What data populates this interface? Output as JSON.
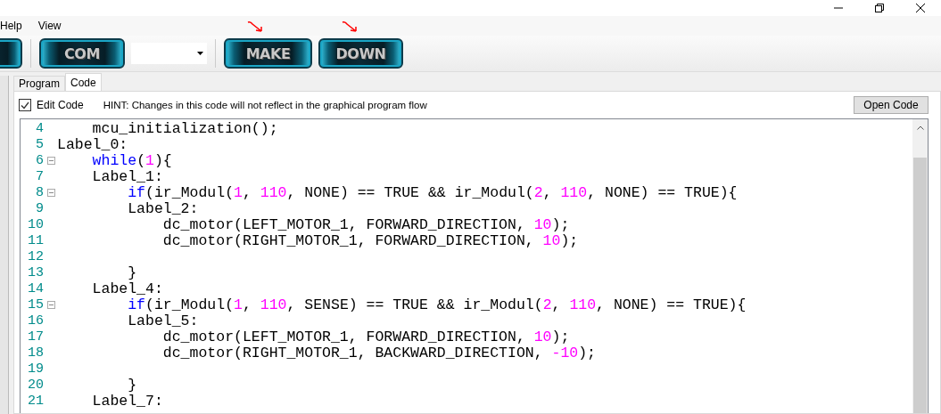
{
  "menu": [
    {
      "label": "Help"
    },
    {
      "label": "View"
    }
  ],
  "toolbar": {
    "buttons": [
      {
        "kind": "partial"
      },
      {
        "kind": "full",
        "label": "COM"
      }
    ],
    "actions": [
      {
        "label": "MAKE",
        "marked": true
      },
      {
        "label": "DOWN",
        "marked": true
      }
    ]
  },
  "tabs": [
    {
      "label": "Program",
      "selected": false
    },
    {
      "label": "Code",
      "selected": true
    }
  ],
  "edit_code": {
    "label": "Edit Code",
    "checked": true
  },
  "hint": "HINT: Changes in this code will not reflect in the graphical program flow",
  "open_button": "Open Code",
  "code_lines": [
    {
      "number": "4",
      "fold": false,
      "tokens": [
        {
          "kind": "plain",
          "text": "    mcu_initialization();"
        }
      ]
    },
    {
      "number": "5",
      "fold": false,
      "tokens": [
        {
          "kind": "plain",
          "text": "Label_0:"
        }
      ]
    },
    {
      "number": "6",
      "fold": true,
      "tokens": [
        {
          "kind": "keyword",
          "text": "    while"
        },
        {
          "kind": "plain",
          "text": "("
        },
        {
          "kind": "number",
          "text": "1"
        },
        {
          "kind": "plain",
          "text": "){"
        }
      ]
    },
    {
      "number": "7",
      "fold": false,
      "tokens": [
        {
          "kind": "plain",
          "text": "    Label_1:"
        }
      ]
    },
    {
      "number": "8",
      "fold": true,
      "tokens": [
        {
          "kind": "keyword",
          "text": "        if"
        },
        {
          "kind": "plain",
          "text": "(ir_Modul("
        },
        {
          "kind": "number",
          "text": "1"
        },
        {
          "kind": "plain",
          "text": ", "
        },
        {
          "kind": "number",
          "text": "110"
        },
        {
          "kind": "plain",
          "text": ", NONE) == TRUE && ir_Modul("
        },
        {
          "kind": "number",
          "text": "2"
        },
        {
          "kind": "plain",
          "text": ", "
        },
        {
          "kind": "number",
          "text": "110"
        },
        {
          "kind": "plain",
          "text": ", NONE) == TRUE){"
        }
      ]
    },
    {
      "number": "9",
      "fold": false,
      "tokens": [
        {
          "kind": "plain",
          "text": "        Label_2:"
        }
      ]
    },
    {
      "number": "10",
      "fold": false,
      "tokens": [
        {
          "kind": "plain",
          "text": "            dc_motor(LEFT_MOTOR_1, FORWARD_DIRECTION, "
        },
        {
          "kind": "number",
          "text": "10"
        },
        {
          "kind": "plain",
          "text": ");"
        }
      ]
    },
    {
      "number": "11",
      "fold": false,
      "tokens": [
        {
          "kind": "plain",
          "text": "            dc_motor(RIGHT_MOTOR_1, FORWARD_DIRECTION, "
        },
        {
          "kind": "number",
          "text": "10"
        },
        {
          "kind": "plain",
          "text": ");"
        }
      ]
    },
    {
      "number": "12",
      "fold": false
    },
    {
      "number": "13",
      "fold": false,
      "tokens": [
        {
          "kind": "plain",
          "text": "        }"
        }
      ]
    },
    {
      "number": "14",
      "fold": false,
      "tokens": [
        {
          "kind": "plain",
          "text": "    Label_4:"
        }
      ]
    },
    {
      "number": "15",
      "fold": true,
      "tokens": [
        {
          "kind": "keyword",
          "text": "        if"
        },
        {
          "kind": "plain",
          "text": "(ir_Modul("
        },
        {
          "kind": "number",
          "text": "1"
        },
        {
          "kind": "plain",
          "text": ", "
        },
        {
          "kind": "number",
          "text": "110"
        },
        {
          "kind": "plain",
          "text": ", SENSE) == TRUE && ir_Modul("
        },
        {
          "kind": "number",
          "text": "2"
        },
        {
          "kind": "plain",
          "text": ", "
        },
        {
          "kind": "number",
          "text": "110"
        },
        {
          "kind": "plain",
          "text": ", NONE) == TRUE){"
        }
      ]
    },
    {
      "number": "16",
      "fold": false,
      "tokens": [
        {
          "kind": "plain",
          "text": "        Label_5:"
        }
      ]
    },
    {
      "number": "17",
      "fold": false,
      "tokens": [
        {
          "kind": "plain",
          "text": "            dc_motor(LEFT_MOTOR_1, FORWARD_DIRECTION, "
        },
        {
          "kind": "number",
          "text": "10"
        },
        {
          "kind": "plain",
          "text": ");"
        }
      ]
    },
    {
      "number": "18",
      "fold": false,
      "tokens": [
        {
          "kind": "plain",
          "text": "            dc_motor(RIGHT_MOTOR_1, BACKWARD_DIRECTION, "
        },
        {
          "kind": "number",
          "text": "-10"
        },
        {
          "kind": "plain",
          "text": ");"
        }
      ]
    },
    {
      "number": "19",
      "fold": false
    },
    {
      "number": "20",
      "fold": false,
      "tokens": [
        {
          "kind": "plain",
          "text": "        }"
        }
      ]
    },
    {
      "number": "21",
      "fold": false,
      "tokens": [
        {
          "kind": "plain",
          "text": "    Label_7:"
        }
      ]
    }
  ]
}
